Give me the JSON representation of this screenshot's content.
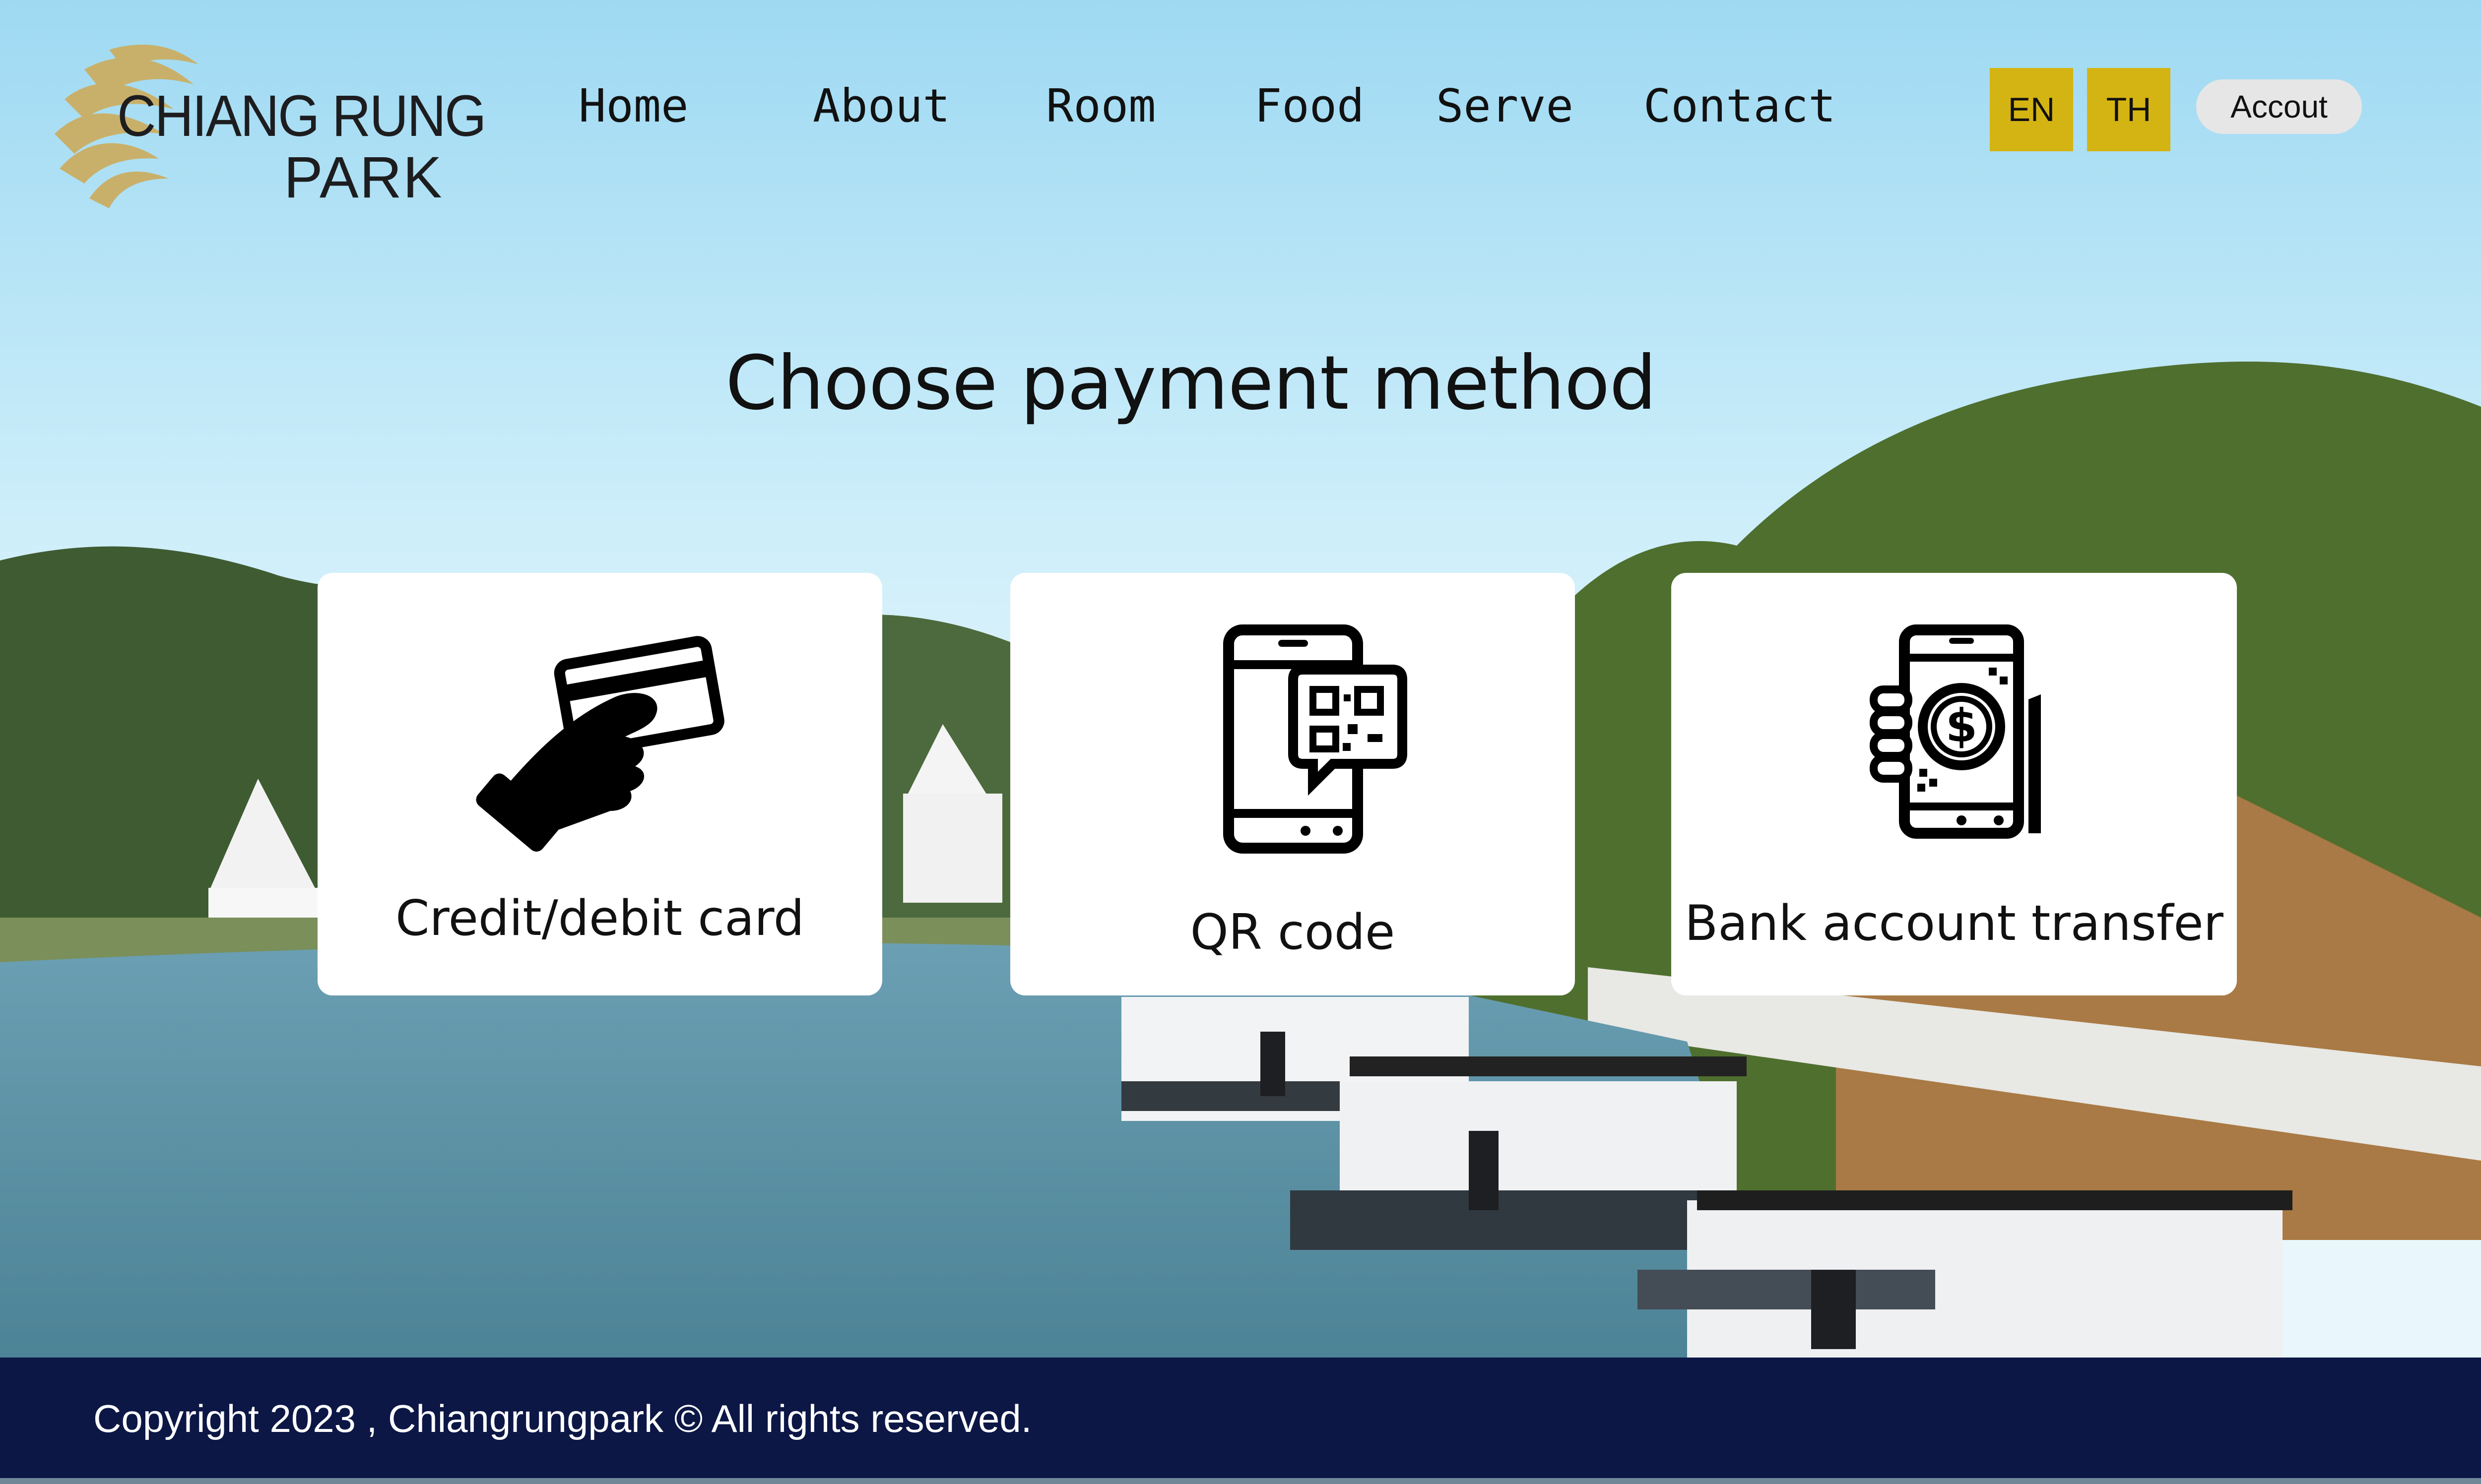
{
  "brand": {
    "line1": "CHIANG RUNG",
    "line2": "PARK",
    "accent_color": "#c9b06a"
  },
  "nav": {
    "items": [
      {
        "label": "Home"
      },
      {
        "label": "About"
      },
      {
        "label": "Room"
      },
      {
        "label": "Food"
      },
      {
        "label": "Serve"
      },
      {
        "label": "Contact"
      }
    ]
  },
  "language": {
    "en_label": "EN",
    "th_label": "TH",
    "button_color": "#d4b413"
  },
  "account": {
    "label": "Accout"
  },
  "main": {
    "title": "Choose payment method",
    "methods": [
      {
        "label": "Credit/debit card",
        "icon": "credit-card-hand-icon"
      },
      {
        "label": "QR code",
        "icon": "qr-phone-icon"
      },
      {
        "label": "Bank account transfer",
        "icon": "mobile-payment-icon"
      }
    ]
  },
  "footer": {
    "copyright": "Copyright 2023 , Chiangrungpark © All rights reserved.",
    "color": "#0c1746"
  }
}
